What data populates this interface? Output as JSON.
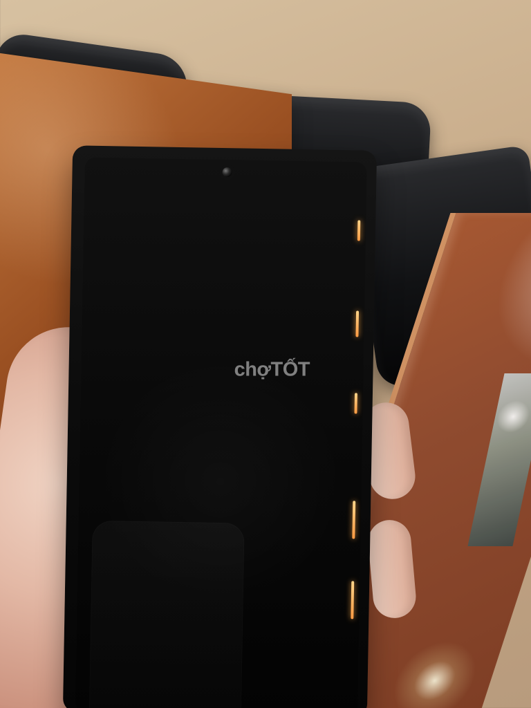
{
  "scene": {
    "watermark_text": "chợTỐT"
  },
  "colors": {
    "floor": "#c7aa88",
    "table": "#8f4b2f",
    "phone": "#0b0b0b",
    "skin": "#e3b8a5",
    "highlight": "#ffd58a"
  },
  "icons": {
    "camera": "camera-icon"
  }
}
